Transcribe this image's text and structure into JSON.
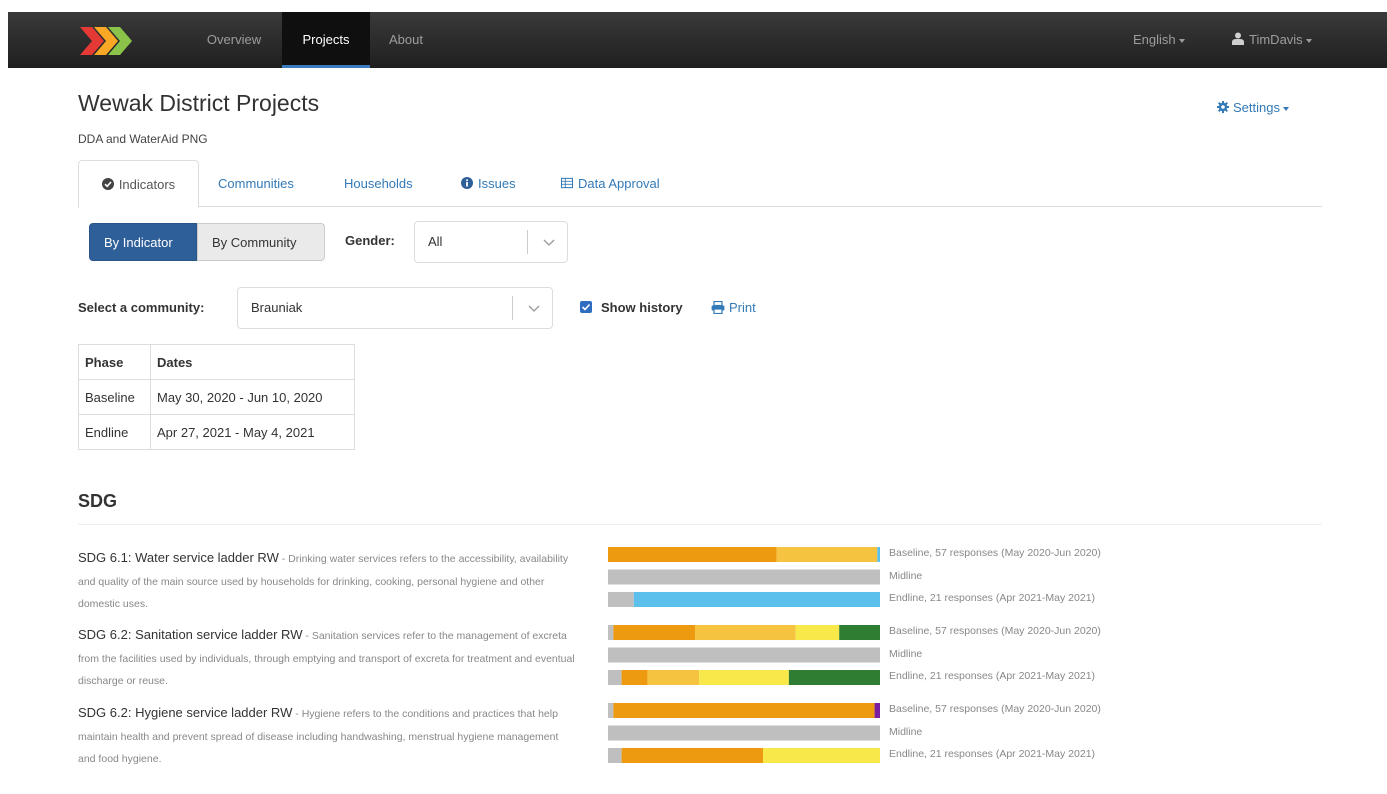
{
  "navbar": {
    "items": [
      {
        "label": "Overview",
        "active": false
      },
      {
        "label": "Projects",
        "active": true
      },
      {
        "label": "About",
        "active": false
      }
    ],
    "language": "English",
    "user": "TimDavis",
    "accent_color": "#3a7bbf"
  },
  "header": {
    "title": "Wewak District Projects",
    "subtitle": "DDA and WaterAid PNG",
    "settings_label": "Settings"
  },
  "tabs": [
    {
      "label": "Indicators",
      "icon": "check-circle-icon",
      "active": true
    },
    {
      "label": "Communities",
      "icon": "",
      "active": false
    },
    {
      "label": "Households",
      "icon": "",
      "active": false
    },
    {
      "label": "Issues",
      "icon": "info-circle-icon",
      "active": false
    },
    {
      "label": "Data Approval",
      "icon": "table-icon",
      "active": false
    }
  ],
  "view_toggle": {
    "by_indicator": "By Indicator",
    "by_community": "By Community",
    "selected": "By Indicator"
  },
  "gender": {
    "label": "Gender:",
    "value": "All"
  },
  "community": {
    "label": "Select a community:",
    "value": "Brauniak"
  },
  "show_history": {
    "label": "Show history",
    "checked": true
  },
  "print_label": "Print",
  "phase_table": {
    "headers": [
      "Phase",
      "Dates"
    ],
    "rows": [
      [
        "Baseline",
        "May 30, 2020 - Jun 10, 2020"
      ],
      [
        "Endline",
        "Apr 27, 2021 - May 4, 2021"
      ]
    ]
  },
  "sdg": {
    "heading": "SDG",
    "indicators": [
      {
        "name": "SDG 6.1: Water service ladder RW",
        "description": " - Drinking water services refers to the accessibility, availability and quality of the main source used by households for drinking, cooking, personal hygiene and other domestic uses."
      },
      {
        "name": "SDG 6.2: Sanitation service ladder RW",
        "description": " - Sanitation services refer to the management of excreta from the facilities used by individuals, through emptying and transport of excreta for treatment and eventual discharge or reuse."
      },
      {
        "name": "SDG 6.2: Hygiene service ladder RW",
        "description": " - Hygiene refers to the conditions and practices that help maintain health and prevent spread of disease including handwashing, menstrual hygiene management and food hygiene."
      }
    ]
  },
  "chart_data": {
    "type": "bar",
    "orientation": "horizontal-stacked-100",
    "groups": [
      {
        "indicator": "SDG 6.1: Water service ladder RW",
        "rows": [
          {
            "label": "Baseline, 57 responses (May 2020-Jun 2020)",
            "segments": [
              {
                "color": "#ee9a11",
                "value": 62
              },
              {
                "color": "#f6c340",
                "value": 37
              },
              {
                "color": "#5bc0eb",
                "value": 1
              }
            ]
          },
          {
            "label": "Midline",
            "segments": [
              {
                "color": "#bfbfbf",
                "value": 100
              }
            ]
          },
          {
            "label": "Endline, 21 responses (Apr 2021-May 2021)",
            "segments": [
              {
                "color": "#bfbfbf",
                "value": 9.5
              },
              {
                "color": "#5bc0eb",
                "value": 90.5
              }
            ]
          }
        ]
      },
      {
        "indicator": "SDG 6.2: Sanitation service ladder RW",
        "rows": [
          {
            "label": "Baseline, 57 responses (May 2020-Jun 2020)",
            "segments": [
              {
                "color": "#bfbfbf",
                "value": 2
              },
              {
                "color": "#ee9a11",
                "value": 30
              },
              {
                "color": "#f6c340",
                "value": 37
              },
              {
                "color": "#f8e84a",
                "value": 16
              },
              {
                "color": "#2e7d32",
                "value": 15
              }
            ]
          },
          {
            "label": "Midline",
            "segments": [
              {
                "color": "#bfbfbf",
                "value": 100
              }
            ]
          },
          {
            "label": "Endline, 21 responses (Apr 2021-May 2021)",
            "segments": [
              {
                "color": "#bfbfbf",
                "value": 5
              },
              {
                "color": "#ee9a11",
                "value": 9.5
              },
              {
                "color": "#f6c340",
                "value": 19
              },
              {
                "color": "#f8e84a",
                "value": 33
              },
              {
                "color": "#2e7d32",
                "value": 33.5
              }
            ]
          }
        ]
      },
      {
        "indicator": "SDG 6.2: Hygiene service ladder RW",
        "rows": [
          {
            "label": "Baseline, 57 responses (May 2020-Jun 2020)",
            "segments": [
              {
                "color": "#bfbfbf",
                "value": 2
              },
              {
                "color": "#ee9a11",
                "value": 96
              },
              {
                "color": "#7b1fa2",
                "value": 2
              }
            ]
          },
          {
            "label": "Midline",
            "segments": [
              {
                "color": "#bfbfbf",
                "value": 100
              }
            ]
          },
          {
            "label": "Endline, 21 responses (Apr 2021-May 2021)",
            "segments": [
              {
                "color": "#bfbfbf",
                "value": 5
              },
              {
                "color": "#ee9a11",
                "value": 52
              },
              {
                "color": "#f8e84a",
                "value": 43
              }
            ]
          }
        ]
      }
    ]
  }
}
